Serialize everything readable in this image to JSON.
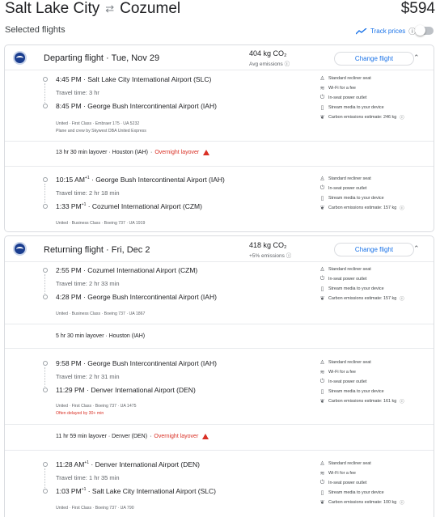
{
  "header": {
    "origin": "Salt Lake City",
    "destination": "Cozumel",
    "price": "$594"
  },
  "selected_label": "Selected flights",
  "track_prices": "Track prices",
  "departing": {
    "title": "Departing flight · Tue, Nov 29",
    "emissions": "404 kg CO₂",
    "emissions_sub": "Avg emissions",
    "change_label": "Change flight",
    "legs": [
      {
        "dep_time": "4:45 PM",
        "dep_airport": "Salt Lake City International Airport (SLC)",
        "travel": "Travel time: 3 hr",
        "arr_time": "8:45 PM",
        "arr_airport": "George Bush Intercontinental Airport (IAH)",
        "meta1": "United · First Class · Embraer 175 · UA 5232",
        "meta2": "Plane and crew by Skywest DBA United Express",
        "amenities": [
          "Standard recliner seat",
          "Wi-Fi for a fee",
          "In-seat power outlet",
          "Stream media to your device",
          "Carbon emissions estimate: 246 kg"
        ]
      },
      {
        "dep_time": "10:15 AM",
        "dep_sup": "+1",
        "dep_airport": "George Bush Intercontinental Airport (IAH)",
        "travel": "Travel time: 2 hr 18 min",
        "arr_time": "1:33 PM",
        "arr_sup": "+1",
        "arr_airport": "Cozumel International Airport (CZM)",
        "meta1": "United · Business Class · Boeing 737 · UA 1919",
        "amenities": [
          "Standard recliner seat",
          "In-seat power outlet",
          "Stream media to your device",
          "Carbon emissions estimate: 157 kg"
        ]
      }
    ],
    "layover": {
      "text": "13 hr 30 min layover · Houston (IAH)",
      "warning": "Overnight layover"
    }
  },
  "returning": {
    "title": "Returning flight · Fri, Dec 2",
    "emissions": "418 kg CO₂",
    "emissions_sub": "+5% emissions",
    "change_label": "Change flight",
    "legs": [
      {
        "dep_time": "2:55 PM",
        "dep_airport": "Cozumel International Airport (CZM)",
        "travel": "Travel time: 2 hr 33 min",
        "arr_time": "4:28 PM",
        "arr_airport": "George Bush Intercontinental Airport (IAH)",
        "meta1": "United · Business Class · Boeing 737 · UA 1867",
        "amenities": [
          "Standard recliner seat",
          "In-seat power outlet",
          "Stream media to your device",
          "Carbon emissions estimate: 157 kg"
        ]
      },
      {
        "dep_time": "9:58 PM",
        "dep_airport": "George Bush Intercontinental Airport (IAH)",
        "travel": "Travel time: 2 hr 31 min",
        "arr_time": "11:29 PM",
        "arr_airport": "Denver International Airport (DEN)",
        "meta1": "United · First Class · Boeing 737 · UA 1475",
        "meta2": "Often delayed by 30+ min",
        "amenities": [
          "Standard recliner seat",
          "Wi-Fi for a fee",
          "In-seat power outlet",
          "Stream media to your device",
          "Carbon emissions estimate: 161 kg"
        ]
      },
      {
        "dep_time": "11:28 AM",
        "dep_sup": "+1",
        "dep_airport": "Denver International Airport (DEN)",
        "travel": "Travel time: 1 hr 35 min",
        "arr_time": "1:03 PM",
        "arr_sup": "+1",
        "arr_airport": "Salt Lake City International Airport (SLC)",
        "meta1": "United · First Class · Boeing 737 · UA 790",
        "amenities": [
          "Standard recliner seat",
          "Wi-Fi for a fee",
          "In-seat power outlet",
          "Stream media to your device",
          "Carbon emissions estimate: 100 kg"
        ]
      }
    ],
    "layovers": [
      {
        "text": "5 hr 30 min layover · Houston (IAH)"
      },
      {
        "text": "11 hr 59 min layover · Denver (DEN)",
        "warning": "Overnight layover"
      }
    ]
  }
}
